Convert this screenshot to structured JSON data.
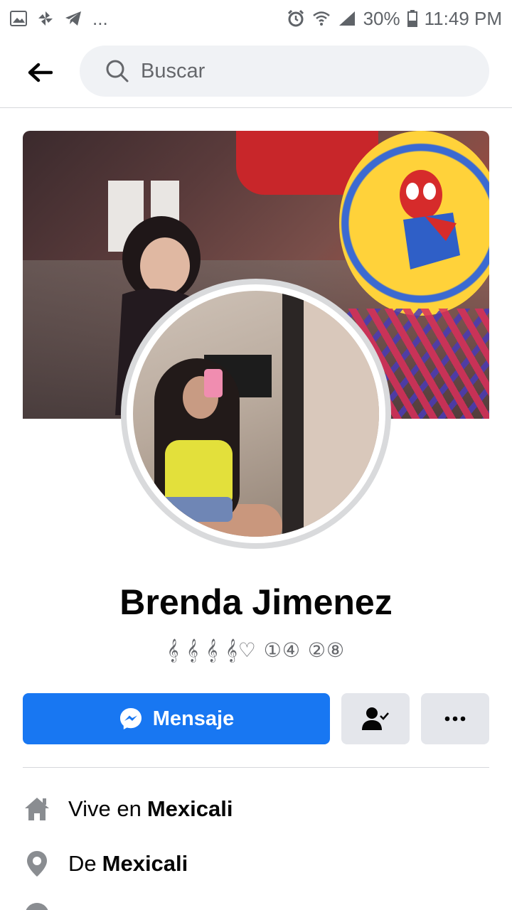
{
  "status_bar": {
    "battery": "30%",
    "time": "11:49 PM",
    "overflow": "..."
  },
  "header": {
    "search_placeholder": "Buscar"
  },
  "profile": {
    "name": "Brenda Jimenez",
    "bio": "𝄞 𝄞 𝄞 𝄞♡ ①④ ②⑧"
  },
  "actions": {
    "message_label": "Mensaje"
  },
  "info": [
    {
      "prefix": "Vive en",
      "value": "Mexicali",
      "icon": "home-icon"
    },
    {
      "prefix": "De",
      "value": "Mexicali",
      "icon": "location-pin-icon"
    }
  ],
  "colors": {
    "primary": "#1877f2",
    "secondary_button": "#e4e6eb",
    "text_secondary": "#65676b"
  }
}
